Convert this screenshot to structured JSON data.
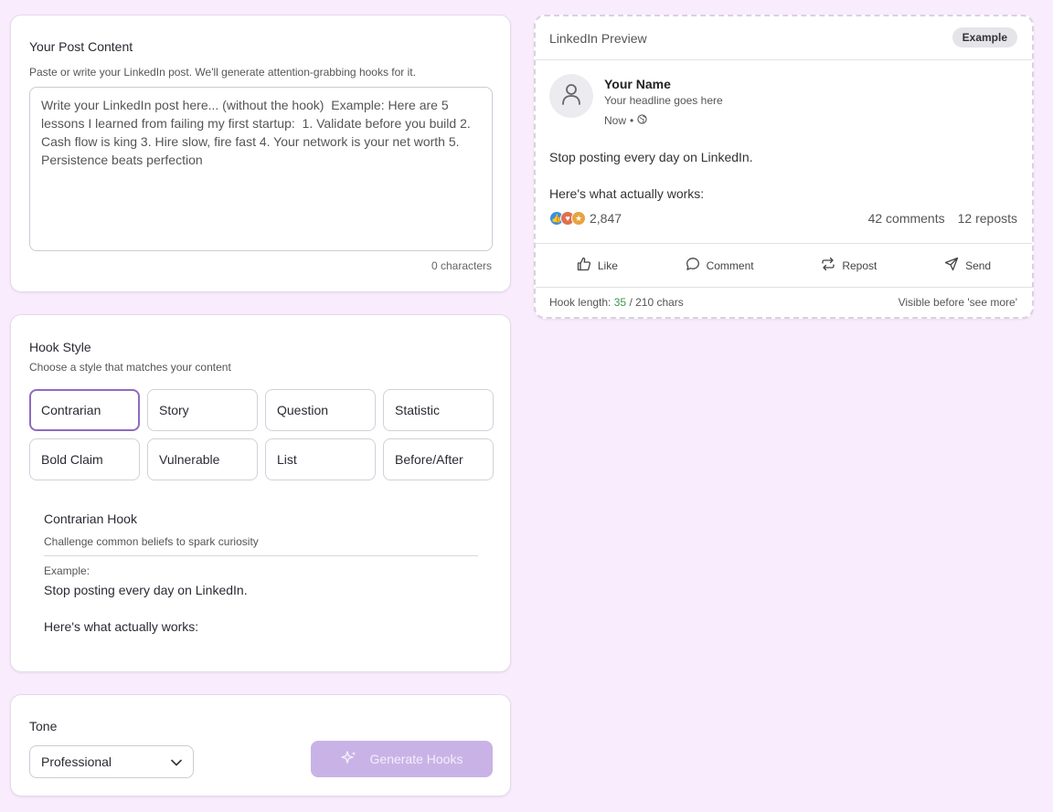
{
  "post_card": {
    "title": "Your Post Content",
    "subtitle": "Paste or write your LinkedIn post. We'll generate attention-grabbing hooks for it.",
    "textarea_value": "",
    "textarea_placeholder": "Write your LinkedIn post here... (without the hook)  Example: Here are 5 lessons I learned from failing my first startup:  1. Validate before you build 2. Cash flow is king 3. Hire slow, fire fast 4. Your network is your net worth 5. Persistence beats perfection",
    "char_count": "0 characters"
  },
  "hook_card": {
    "title": "Hook Style",
    "subtitle": "Choose a style that matches your content",
    "styles": [
      {
        "label": "Contrarian",
        "selected": true
      },
      {
        "label": "Story",
        "selected": false
      },
      {
        "label": "Question",
        "selected": false
      },
      {
        "label": "Statistic",
        "selected": false
      },
      {
        "label": "Bold Claim",
        "selected": false
      },
      {
        "label": "Vulnerable",
        "selected": false
      },
      {
        "label": "List",
        "selected": false
      },
      {
        "label": "Before/After",
        "selected": false
      }
    ],
    "info": {
      "name": "Contrarian Hook",
      "description": "Challenge common beliefs to spark curiosity",
      "example_label": "Example:",
      "example_line1": "Stop posting every day on LinkedIn.",
      "example_line2": "Here's what actually works:"
    }
  },
  "tone_card": {
    "label": "Tone",
    "selected": "Professional",
    "generate_label": "Generate Hooks"
  },
  "preview": {
    "title": "LinkedIn Preview",
    "badge": "Example",
    "user_name": "Your Name",
    "headline": "Your headline goes here",
    "time": "Now",
    "separator": "•",
    "line1": "Stop posting every day on LinkedIn.",
    "line2": "Here's what actually works:",
    "reaction_count": "2,847",
    "comments": "42 comments",
    "reposts": "12 reposts",
    "actions": {
      "like": "Like",
      "comment": "Comment",
      "repost": "Repost",
      "send": "Send"
    },
    "hook_length_label": "Hook length:",
    "hook_length_count": "35",
    "hook_length_max": "/ 210 chars",
    "visible_note": "Visible before 'see more'"
  },
  "colors": {
    "background": "#f9ecfd",
    "accent": "#8e6bc0",
    "generate_button": "#c9b3e6",
    "hook_length_ok": "#3a9a4a"
  }
}
